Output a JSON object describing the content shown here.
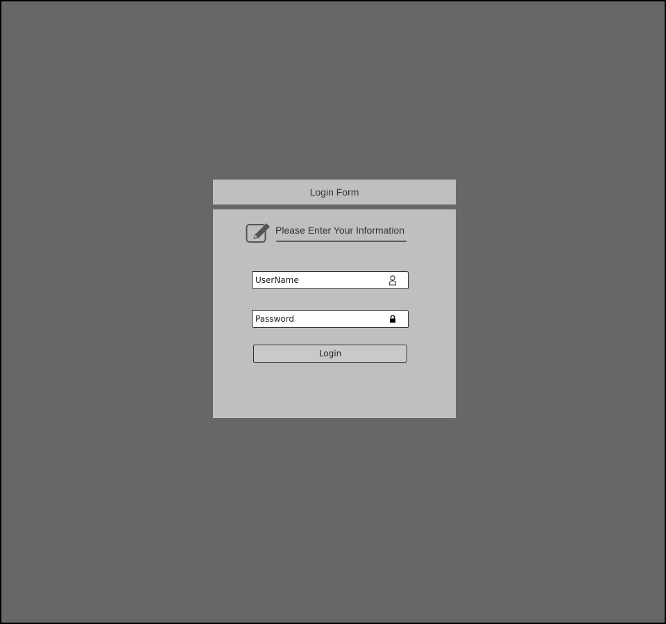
{
  "form": {
    "title": "Login Form",
    "instruction": "Please Enter Your Information",
    "username_placeholder": "UserName",
    "password_placeholder": "Password",
    "login_label": "Login"
  },
  "icons": {
    "header": "edit-icon",
    "username": "user-icon",
    "password": "lock-icon"
  },
  "colors": {
    "background": "#676767",
    "panel": "#bfbfbf",
    "button": "#c9c9c9",
    "field": "#ffffff"
  }
}
